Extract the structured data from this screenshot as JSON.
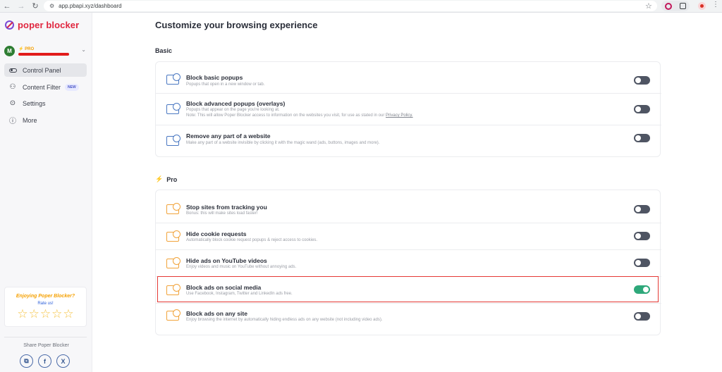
{
  "browser": {
    "url": "app.pbapi.xyz/dashboard"
  },
  "sidebar": {
    "brand": "poper blocker",
    "user": {
      "avatar_initial": "M",
      "plan": "⚡ PRO"
    },
    "menu": [
      {
        "label": "Control Panel",
        "active": true
      },
      {
        "label": "Content Filter",
        "badge": "NEW"
      },
      {
        "label": "Settings"
      },
      {
        "label": "More"
      }
    ],
    "rate_card": {
      "title": "Enjoying Poper Blocker?",
      "link": "Rate us!",
      "stars": 5
    },
    "share_label": "Share Poper Blocker"
  },
  "main": {
    "title": "Customize your browsing experience",
    "basic_section": {
      "label": "Basic",
      "rows": [
        {
          "title": "Block basic popups",
          "desc": "Popups that open in a new window or tab.",
          "enabled": false
        },
        {
          "title": "Block advanced popups (overlays)",
          "desc": "Popups that appear on the page you're looking at.",
          "note": "Note: This will allow Poper Blocker access to information on the websites you visit, for use as stated in our",
          "privacy_link": "Privacy Policy.",
          "enabled": false
        },
        {
          "title": "Remove any part of a website",
          "desc": "Make any part of a website invisible by clicking it with the magic wand (ads, buttons, images and more).",
          "enabled": false
        }
      ]
    },
    "pro_section": {
      "label": "Pro",
      "rows": [
        {
          "title": "Stop sites from tracking you",
          "desc": "Bonus: this will make sites load faster!",
          "enabled": false
        },
        {
          "title": "Hide cookie requests",
          "desc": "Automatically block cookie request popups & reject access to cookies.",
          "enabled": false
        },
        {
          "title": "Hide ads on YouTube videos",
          "desc": "Enjoy videos and music on YouTube without annoying ads.",
          "enabled": false
        },
        {
          "title": "Block ads on social media",
          "desc": "Use Facebook, Instagram, Twitter and LinkedIn ads free.",
          "enabled": true
        },
        {
          "title": "Block ads on any site",
          "desc": "Enjoy browsing the internet by automatically hiding endless ads on any website (not including video ads).",
          "enabled": false
        }
      ]
    }
  },
  "colors": {
    "brand": "#e0263f",
    "pro_accent": "#f5a000",
    "toggle_on": "#2ea87a",
    "toggle_off": "#4f5563",
    "highlight": "#e53935"
  }
}
